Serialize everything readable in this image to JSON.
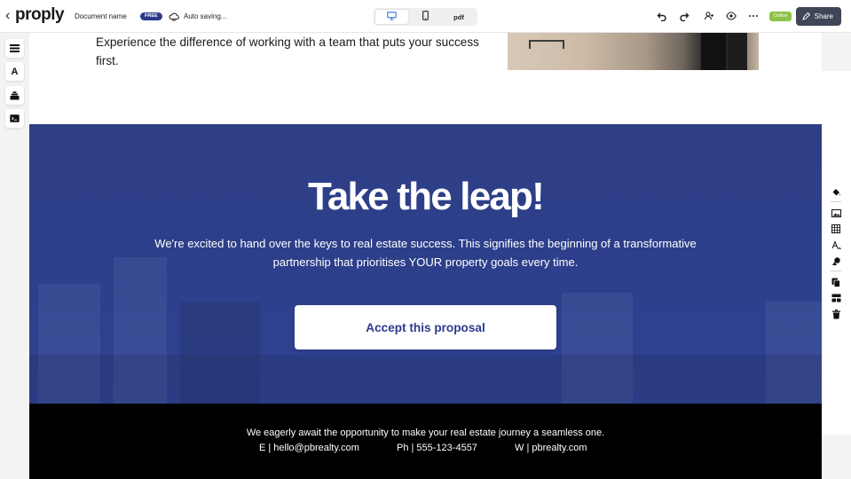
{
  "topbar": {
    "logo": "proply",
    "back_glyph": "‹",
    "document_name": "Document name",
    "plan_badge": "FREE",
    "autosave_status": "Auto saving...",
    "devices": {
      "pdf_label": "pdf"
    },
    "online_badge": "Online",
    "share_label": "Share"
  },
  "left_tools": [
    {
      "name": "layout-icon",
      "glyph": "☰"
    },
    {
      "name": "text-icon",
      "glyph": "A"
    },
    {
      "name": "blocks-icon",
      "glyph": ""
    },
    {
      "name": "code-icon",
      "glyph": ""
    }
  ],
  "right_tools": [
    "paint-bucket-icon",
    "image-icon",
    "table-icon",
    "text-style-icon",
    "shapes-icon",
    "duplicate-icon",
    "layout-block-icon",
    "trash-icon"
  ],
  "content": {
    "intro_text": "Experience the difference of working with a team that puts your success first.",
    "hero": {
      "title": "Take the leap!",
      "subtitle": "We're excited to hand over the keys to real estate success. This signifies the beginning of a transformative partnership that prioritises YOUR property goals every time.",
      "cta_label": "Accept this proposal"
    },
    "footer": {
      "line": "We eagerly await the opportunity to make your real estate journey a seamless one.",
      "email": "E | hello@pbrealty.com",
      "phone": "Ph | 555-123-4557",
      "web": "W | pbrealty.com"
    }
  },
  "colors": {
    "brand_navy": "#2b3a8c",
    "hero_overlay": "#2d3f8a",
    "footer_bg": "#000000",
    "online_green": "#8bc34a",
    "share_bg": "#3f4656"
  }
}
